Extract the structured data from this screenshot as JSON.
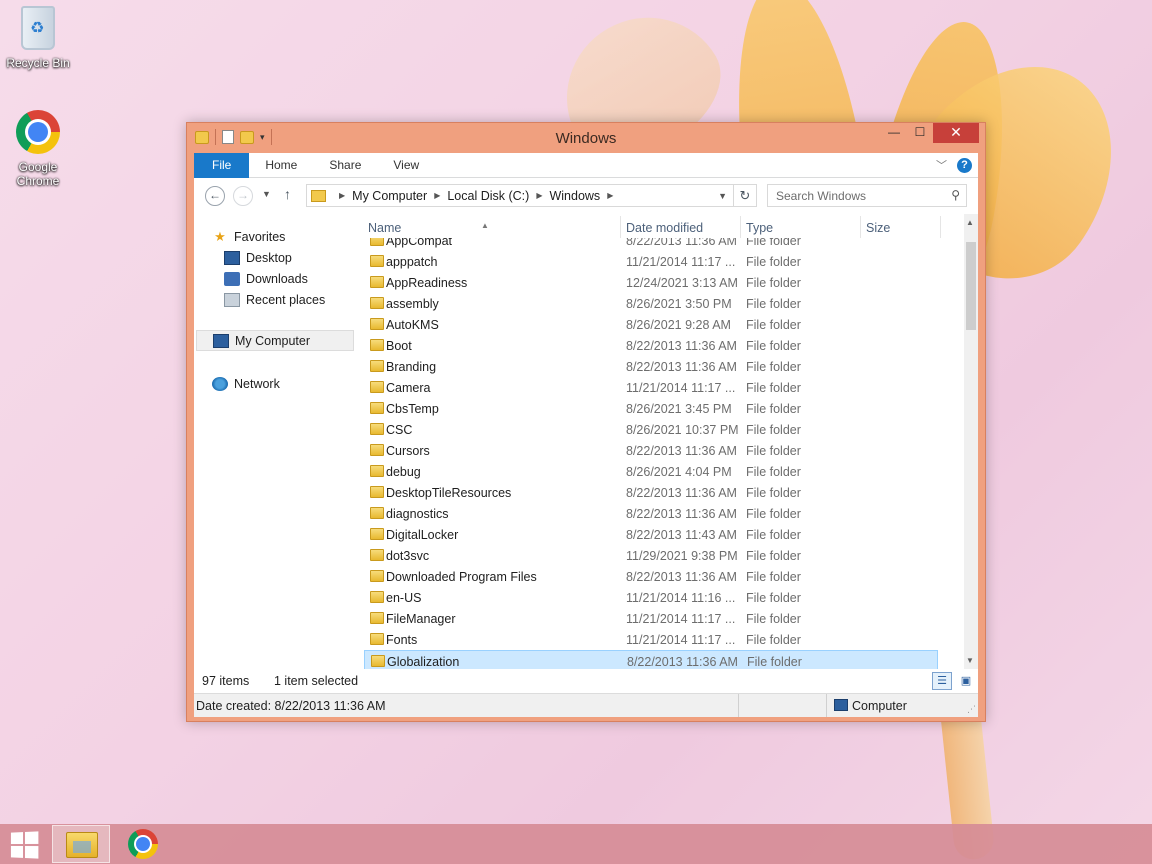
{
  "desktop": {
    "icons": [
      {
        "label": "Recycle Bin",
        "icon": "recycle-bin-icon"
      },
      {
        "label": "Google Chrome",
        "icon": "chrome-icon"
      }
    ]
  },
  "window": {
    "title": "Windows",
    "buttons": {
      "minimize": "—",
      "maximize": "☐",
      "close": "✕"
    }
  },
  "ribbon": {
    "tabs": [
      "File",
      "Home",
      "Share",
      "View"
    ],
    "help": "?"
  },
  "address": {
    "crumbs": [
      "My Computer",
      "Local Disk (C:)",
      "Windows"
    ],
    "search_placeholder": "Search Windows"
  },
  "nav": {
    "favorites": "Favorites",
    "desktop": "Desktop",
    "downloads": "Downloads",
    "recent": "Recent places",
    "computer": "My Computer",
    "network": "Network"
  },
  "columns": {
    "name": "Name",
    "date": "Date modified",
    "type": "Type",
    "size": "Size"
  },
  "files": [
    {
      "name": "AppCompat",
      "date": "8/22/2013 11:36 AM",
      "type": "File folder"
    },
    {
      "name": "apppatch",
      "date": "11/21/2014 11:17 ...",
      "type": "File folder"
    },
    {
      "name": "AppReadiness",
      "date": "12/24/2021 3:13 AM",
      "type": "File folder"
    },
    {
      "name": "assembly",
      "date": "8/26/2021 3:50 PM",
      "type": "File folder"
    },
    {
      "name": "AutoKMS",
      "date": "8/26/2021 9:28 AM",
      "type": "File folder"
    },
    {
      "name": "Boot",
      "date": "8/22/2013 11:36 AM",
      "type": "File folder"
    },
    {
      "name": "Branding",
      "date": "8/22/2013 11:36 AM",
      "type": "File folder"
    },
    {
      "name": "Camera",
      "date": "11/21/2014 11:17 ...",
      "type": "File folder"
    },
    {
      "name": "CbsTemp",
      "date": "8/26/2021 3:45 PM",
      "type": "File folder"
    },
    {
      "name": "CSC",
      "date": "8/26/2021 10:37 PM",
      "type": "File folder"
    },
    {
      "name": "Cursors",
      "date": "8/22/2013 11:36 AM",
      "type": "File folder"
    },
    {
      "name": "debug",
      "date": "8/26/2021 4:04 PM",
      "type": "File folder"
    },
    {
      "name": "DesktopTileResources",
      "date": "8/22/2013 11:36 AM",
      "type": "File folder"
    },
    {
      "name": "diagnostics",
      "date": "8/22/2013 11:36 AM",
      "type": "File folder"
    },
    {
      "name": "DigitalLocker",
      "date": "8/22/2013 11:43 AM",
      "type": "File folder"
    },
    {
      "name": "dot3svc",
      "date": "11/29/2021 9:38 PM",
      "type": "File folder"
    },
    {
      "name": "Downloaded Program Files",
      "date": "8/22/2013 11:36 AM",
      "type": "File folder"
    },
    {
      "name": "en-US",
      "date": "11/21/2014 11:16 ...",
      "type": "File folder"
    },
    {
      "name": "FileManager",
      "date": "11/21/2014 11:17 ...",
      "type": "File folder"
    },
    {
      "name": "Fonts",
      "date": "11/21/2014 11:17 ...",
      "type": "File folder"
    },
    {
      "name": "Globalization",
      "date": "8/22/2013 11:36 AM",
      "type": "File folder"
    }
  ],
  "selected_index": 20,
  "status": {
    "count": "97 items",
    "selection": "1 item selected",
    "date_created": "Date created: 8/22/2013 11:36 AM",
    "location": "Computer"
  },
  "colors": {
    "accent": "#1979ca",
    "title_bar": "#f0a07f",
    "close": "#c7403a",
    "selection": "#cce8ff"
  }
}
